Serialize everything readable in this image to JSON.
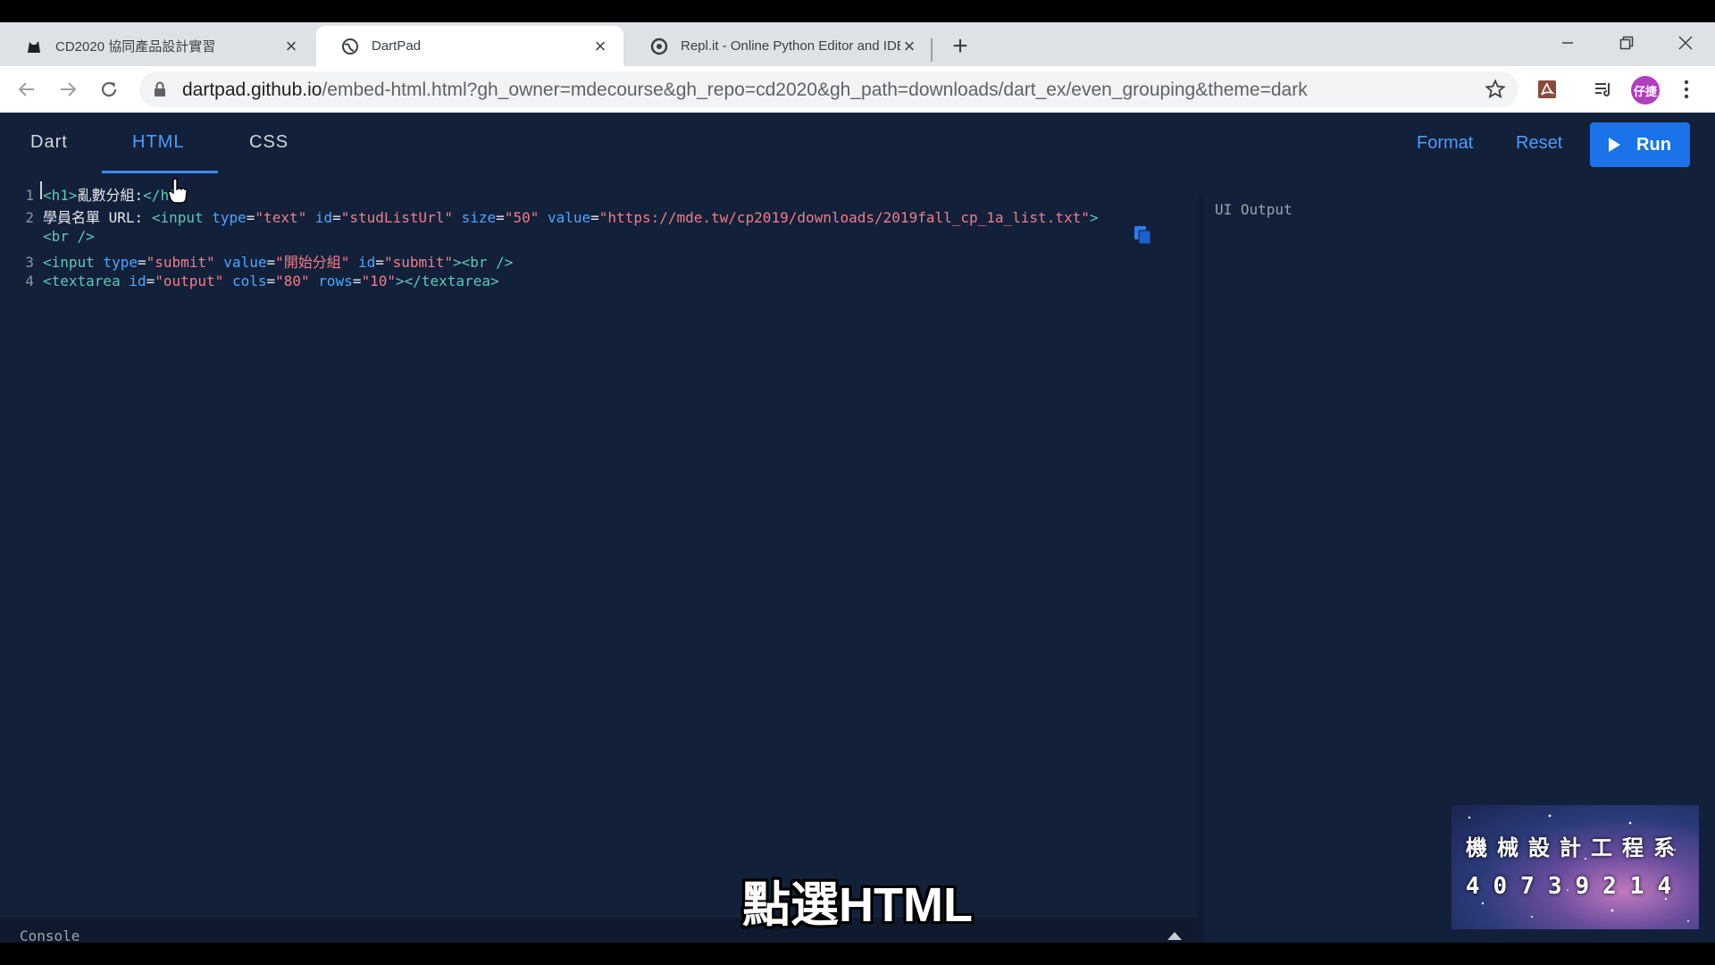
{
  "browser": {
    "tabs": [
      {
        "title": "CD2020 協同產品設計實習",
        "favicon": "github-cat-icon",
        "active": false
      },
      {
        "title": "DartPad",
        "favicon": "globe-icon",
        "active": true
      },
      {
        "title": "Repl.it - Online Python Editor and IDE",
        "favicon": "replit-icon",
        "active": false
      }
    ],
    "url_host": "dartpad.github.io",
    "url_path": "/embed-html.html?gh_owner=mdecourse&gh_repo=cd2020&gh_path=downloads/dart_ex/even_grouping&theme=dark",
    "avatar_text": "仔捷"
  },
  "dartpad": {
    "tabs": [
      "Dart",
      "HTML",
      "CSS"
    ],
    "active_tab": "HTML",
    "format_label": "Format",
    "reset_label": "Reset",
    "run_label": "Run",
    "ui_output_label": "UI Output",
    "console_label": "Console",
    "code_lines": {
      "l1": {
        "n": "1",
        "a": "<h1>",
        "b": "亂數分組:",
        "c": "</h1>"
      },
      "l2": {
        "n": "2",
        "a": "學員名單 URL: ",
        "b": "<input",
        "c": " type",
        "d": "=",
        "e": "\"text\"",
        "f": " id",
        "g": "=",
        "h": "\"studListUrl\"",
        "i": " size",
        "j": "=",
        "k": "\"50\"",
        "l": " value",
        "m": "=",
        "o": "\"https://mde.tw/cp2019/downloads/2019fall_cp_1a_list.txt\"",
        "p": ">"
      },
      "l2b": {
        "a": "<br />"
      },
      "l3": {
        "n": "3",
        "a": "<input",
        "b": " type",
        "c": "=",
        "d": "\"submit\"",
        "e": " value",
        "f": "=",
        "g": "\"開始分組\"",
        "h": " id",
        "i": "=",
        "j": "\"submit\"",
        "k": "><br />"
      },
      "l4": {
        "n": "4",
        "a": "<textarea",
        "b": " id",
        "c": "=",
        "d": "\"output\"",
        "e": " cols",
        "f": "=",
        "g": "\"80\"",
        "h": " rows",
        "i": "=",
        "j": "\"10\"",
        "k": "></textarea>"
      }
    }
  },
  "overlay": {
    "subtitle": "點選HTML",
    "watermark_line1": "機械設計工程系",
    "watermark_line2": "40739214"
  },
  "colors": {
    "editor_bg": "#13203a",
    "accent": "#4b9cff",
    "run_button": "#1a73e8"
  }
}
